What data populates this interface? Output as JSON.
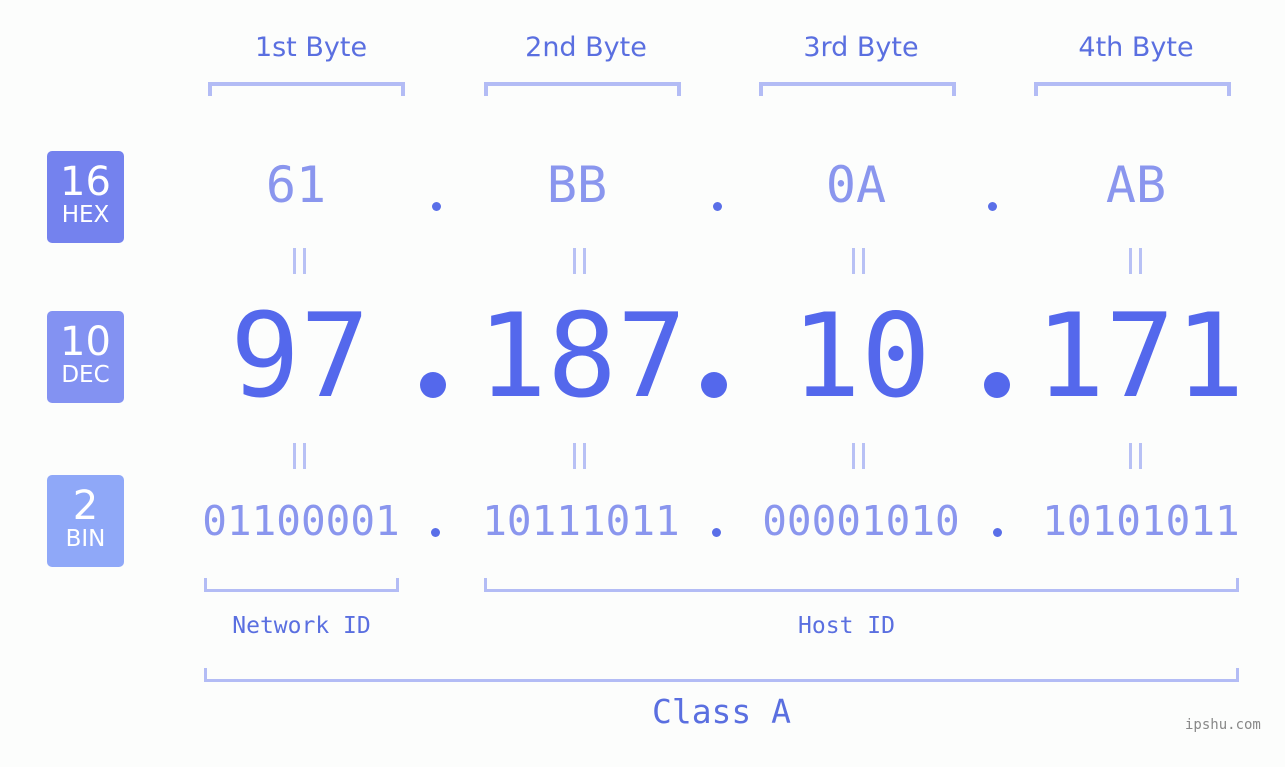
{
  "byte_headers": [
    "1st Byte",
    "2nd Byte",
    "3rd Byte",
    "4th Byte"
  ],
  "badges": [
    {
      "number": "16",
      "unit": "HEX",
      "color": "#7482ee"
    },
    {
      "number": "10",
      "unit": "DEC",
      "color": "#8392f2"
    },
    {
      "number": "2",
      "unit": "BIN",
      "color": "#8fa8f8"
    }
  ],
  "hex": [
    "61",
    "BB",
    "0A",
    "AB"
  ],
  "dec": [
    "97",
    "187",
    "10",
    "171"
  ],
  "bin": [
    "01100001",
    "10111011",
    "00001010",
    "10101011"
  ],
  "network_id_label": "Network ID",
  "host_id_label": "Host ID",
  "class_label": "Class A",
  "watermark": "ipshu.com"
}
